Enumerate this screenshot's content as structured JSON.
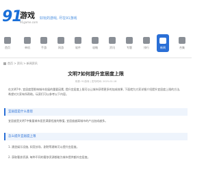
{
  "brand": {
    "logo_number": "91",
    "logo_text": "游戏",
    "logo_subtext": "91game.com",
    "slogan": "好玩的游戏, 尽在91游戏"
  },
  "nav": {
    "items": [
      {
        "label": "首页",
        "icon": "home-icon"
      },
      {
        "label": "单机",
        "icon": "gamepad-icon"
      },
      {
        "label": "手游",
        "icon": "phone-icon"
      },
      {
        "label": "网游",
        "icon": "globe-icon"
      },
      {
        "label": "软件",
        "icon": "app-icon"
      },
      {
        "label": "攻略",
        "icon": "book-icon"
      },
      {
        "label": "资讯",
        "icon": "news-icon"
      },
      {
        "label": "专题",
        "icon": "grid-icon"
      },
      {
        "label": "排行",
        "icon": "rank-icon"
      },
      {
        "label": "新闻",
        "icon": "newspaper-icon"
      },
      {
        "label": "合集",
        "icon": "folder-icon"
      }
    ],
    "active_index": 9
  },
  "breadcrumb": "首页 > 资讯 > 新闻资讯",
  "article": {
    "title": "文明7如何提升宜居度上限",
    "meta": "来源: 91游戏 | 发布时间: 2025-02-18",
    "intro": "在文明7中, 宜居度是影响城市发展的重要因素, 提升宜居度上限可以让城市获得更多的加成效果, 下面就为大家详细介绍提升宜居度上限的方法, 希望对大家有所帮助。玩家们可以参考以下内容。",
    "section1": "宜居度是什么意思",
    "section1_body": "宜居度是文明7中衡量城市居民满意程度的数值, 宜居度越高城市的产出加成越多。",
    "section2": "怎么提升宜居度上限",
    "bullet1": "1. 建造娱乐设施, 如竞技场、剧院等建筑可以提升宜居度。",
    "bullet2": "2. 获取奢侈资源, 每种不同的奢侈资源都能为城市提供额外宜居度。"
  },
  "colors": {
    "brand_blue": "#2a6fd6",
    "logo_blue": "#1a6fd8",
    "section_bg": "#eef4fc"
  }
}
